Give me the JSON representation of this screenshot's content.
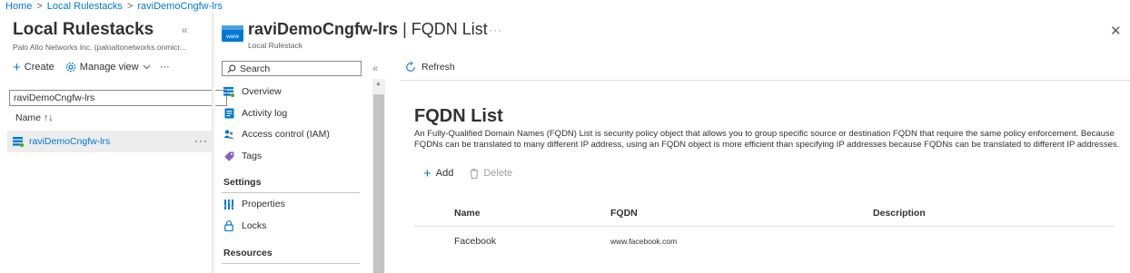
{
  "breadcrumb": [
    "Home",
    "Local Rulestacks",
    "raviDemoCngfw-lrs"
  ],
  "breadcrumb_separator": ">",
  "left_blade": {
    "title": "Local Rulestacks",
    "collapse_glyph": "«",
    "subtitle": "Palo Alto Networks Inc. (paloaltonetworks.onmicr...",
    "toolbar": {
      "create_label": "Create",
      "manage_view_label": "Manage view",
      "more_glyph": "···"
    },
    "filter_value": "raviDemoCngfw-lrs",
    "name_header": "Name ↑↓",
    "rows": [
      {
        "label": "raviDemoCngfw-lrs",
        "more_glyph": "···"
      }
    ]
  },
  "resource": {
    "name": "raviDemoCngfw-lrs",
    "page": "FQDN List",
    "separator": "|",
    "subtitle": "Local Rulestack",
    "icon": "www-icon",
    "more_glyph": "···",
    "close_glyph": "✕"
  },
  "menu": {
    "search_placeholder": "Search",
    "collapse_glyph": "«",
    "items": [
      {
        "label": "Overview",
        "icon": "overview-icon"
      },
      {
        "label": "Activity log",
        "icon": "activity-log-icon"
      },
      {
        "label": "Access control (IAM)",
        "icon": "iam-icon"
      },
      {
        "label": "Tags",
        "icon": "tag-icon"
      }
    ],
    "settings_header": "Settings",
    "settings_items": [
      {
        "label": "Properties",
        "icon": "properties-icon"
      },
      {
        "label": "Locks",
        "icon": "lock-icon"
      }
    ],
    "resources_header": "Resources"
  },
  "content": {
    "refresh_label": "Refresh",
    "heading": "FQDN List",
    "description": "An Fully-Qualified Domain Names (FQDN) List is security policy object that allows you to group specific source or destination FQDN that require the same policy enforcement. Because FQDNs can be translated to many different IP address, using an FQDN object is more efficient than specifying IP addresses because FQDNs can be translated to different IP addresses.",
    "add_label": "Add",
    "delete_label": "Delete",
    "table": {
      "columns": [
        "Name",
        "FQDN",
        "Description"
      ],
      "rows": [
        {
          "name": "Facebook",
          "fqdn": "www.facebook.com",
          "description": ""
        }
      ]
    }
  },
  "colors": {
    "accent": "#0078d4",
    "selected_row": "#ededed",
    "disabled_text": "#a19f9d"
  }
}
